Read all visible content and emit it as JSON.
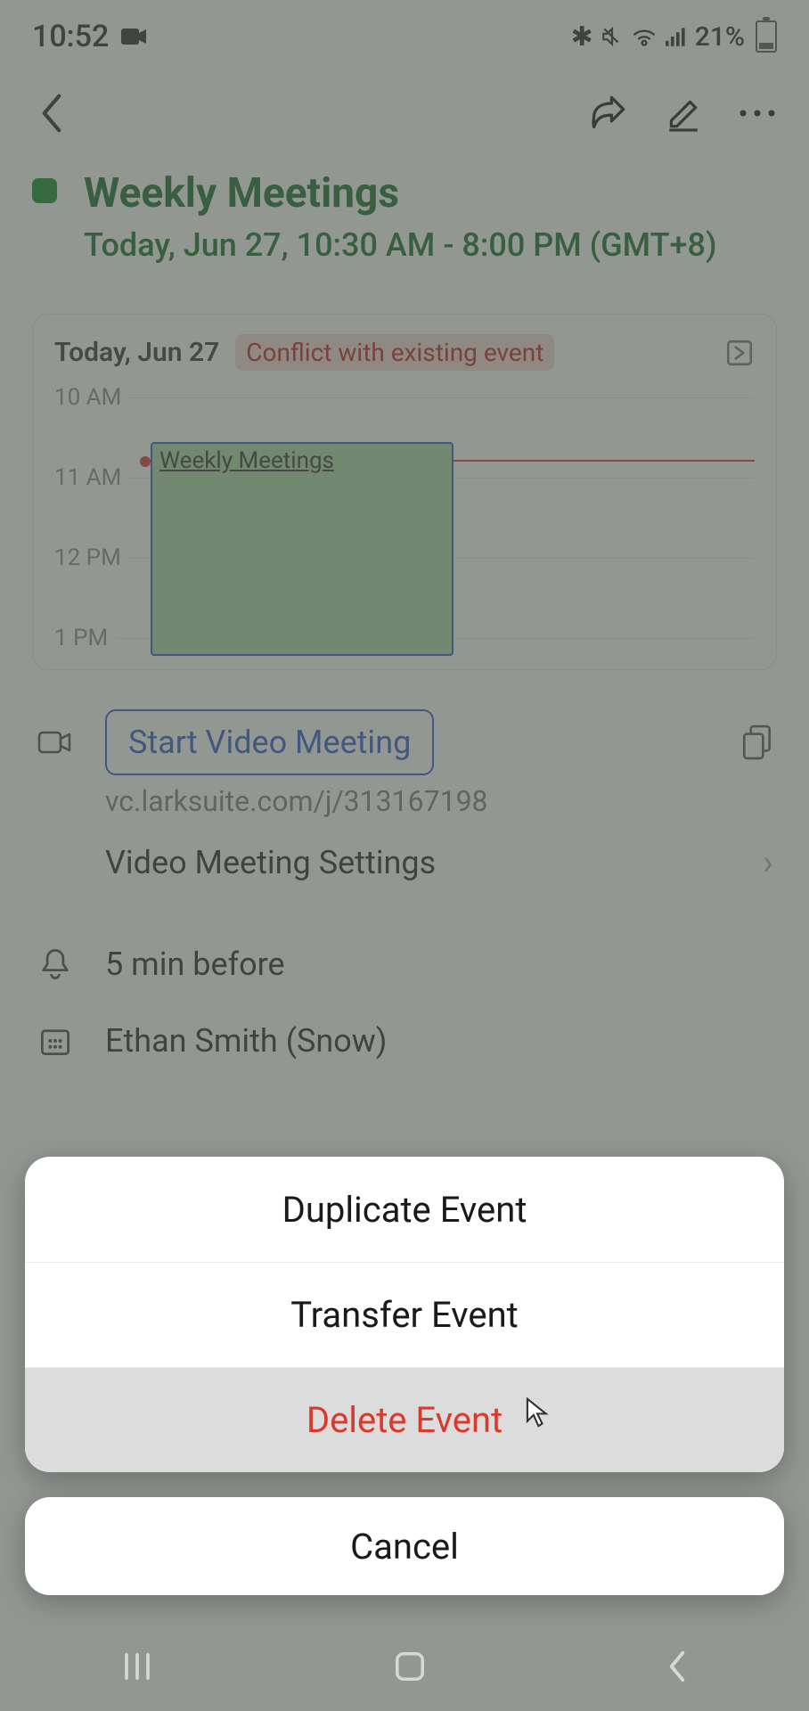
{
  "status": {
    "time": "10:52",
    "battery_pct": "21%"
  },
  "event": {
    "title": "Weekly Meetings",
    "datetime_line": "Today, Jun 27, 10:30 AM - 8:00 PM (GMT+8)",
    "color": "#0a8a23"
  },
  "timeline": {
    "date_label": "Today, Jun 27",
    "conflict_label": "Conflict with existing event",
    "hours": [
      "10 AM",
      "11 AM",
      "12 PM",
      "1 PM"
    ],
    "block_title": "Weekly Meetings"
  },
  "video": {
    "start_button": "Start Video Meeting",
    "link": "vc.larksuite.com/j/313167198",
    "settings_label": "Video Meeting Settings"
  },
  "reminder": {
    "text": "5 min before"
  },
  "organizer": {
    "name": "Ethan Smith (Snow)"
  },
  "sheet": {
    "duplicate": "Duplicate Event",
    "transfer": "Transfer Event",
    "delete": "Delete Event",
    "cancel": "Cancel"
  }
}
